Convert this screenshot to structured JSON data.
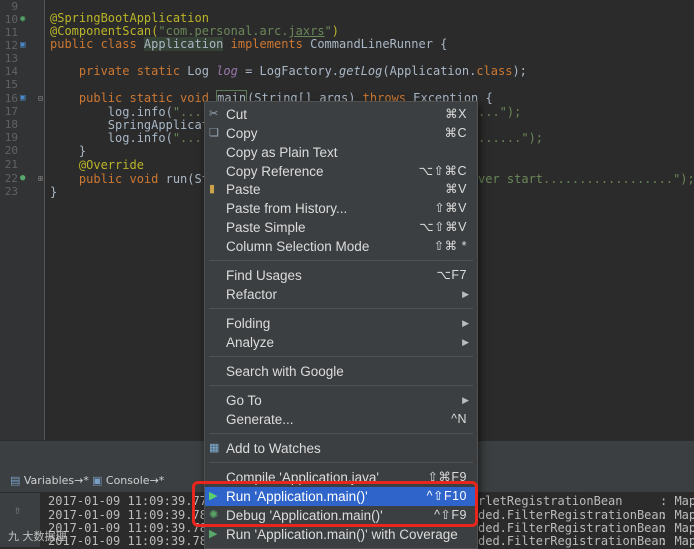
{
  "editor": {
    "line_numbers": [
      "9",
      "10",
      "11",
      "12",
      "13",
      "14",
      "15",
      "16",
      "17",
      "18",
      "19",
      "20",
      "21",
      "22",
      "23"
    ],
    "lines": {
      "l9": "@SpringBootApplication",
      "l10_a": "@ComponentScan(",
      "l10_b": "\"com.personal.arc.",
      "l10_c": "jaxrs",
      "l10_d": "\"",
      "l10_e": ")",
      "l11_a": "public class ",
      "l11_b": "Application",
      "l11_c": " implements ",
      "l11_d": "CommandLineRunner {",
      "l13_a": "    private static ",
      "l13_b": "Log ",
      "l13_c": "log",
      "l13_d": " = LogFactory.",
      "l13_e": "getLog",
      "l13_f": "(Application.",
      "l13_g": "class",
      "l13_h": ");",
      "l16_a": "    public static void ",
      "l16_b": "main",
      "l16_c": "(String[] args) ",
      "l16_d": "throws ",
      "l16_e": "Exception {",
      "l17_a": "        log.info(",
      "l17_b": "\"........",
      "l17_c": "...\");",
      "l18": "        SpringApplication",
      "l19_a": "        log.info(",
      "l19_b": "\"........",
      "l19_c": "......\");",
      "l20": "    }",
      "l21": "    @Override",
      "l22_a": "    public void ",
      "l22_b": "run(Strin",
      "l22_c": "ver start..................\");",
      "l22_d": " }",
      "l23": "}"
    }
  },
  "tool_window": {
    "tabs": [
      {
        "label": "Variables",
        "suffix": "→*"
      },
      {
        "label": "Console",
        "suffix": "→*"
      }
    ]
  },
  "console": {
    "lines": [
      {
        "time": "2017-01-09 11:09:39.778",
        "right": "rletRegistrationBean",
        "tail": ": Mapp"
      },
      {
        "time": "2017-01-09 11:09:39.782",
        "right": "ded.FilterRegistrationBean",
        "tail": ": Mapp"
      },
      {
        "time": "2017-01-09 11:09:39.782",
        "right": "ded.FilterRegistrationBean",
        "tail": ": Mapp"
      },
      {
        "time": "2017-01-09 11:09:39.782",
        "right": "ded.FilterRegistrationBean",
        "tail": ": Mapp"
      }
    ],
    "watermark": "九 大数据理"
  },
  "context_menu": {
    "items": [
      {
        "label": "Cut",
        "shortcut": "⌘X",
        "icon": "scissors-icon"
      },
      {
        "label": "Copy",
        "shortcut": "⌘C",
        "icon": "copy-icon"
      },
      {
        "label": "Copy as Plain Text",
        "shortcut": ""
      },
      {
        "label": "Copy Reference",
        "shortcut": "⌥⇧⌘C"
      },
      {
        "label": "Paste",
        "shortcut": "⌘V",
        "icon": "paste-icon"
      },
      {
        "label": "Paste from History...",
        "shortcut": "⇧⌘V"
      },
      {
        "label": "Paste Simple",
        "shortcut": "⌥⇧⌘V"
      },
      {
        "label": "Column Selection Mode",
        "shortcut": "⇧⌘  *"
      },
      {
        "label": "Find Usages",
        "shortcut": "⌥F7"
      },
      {
        "label": "Refactor",
        "submenu": true
      },
      {
        "label": "Folding",
        "submenu": true
      },
      {
        "label": "Analyze",
        "submenu": true
      },
      {
        "label": "Search with Google",
        "shortcut": ""
      },
      {
        "label": "Go To",
        "submenu": true
      },
      {
        "label": "Generate...",
        "shortcut": "^N"
      },
      {
        "label": "Add to Watches",
        "shortcut": "",
        "icon": "watches-icon"
      },
      {
        "label": "Compile 'Application.java'",
        "shortcut": "⇧⌘F9"
      },
      {
        "label": "Run 'Application.main()'",
        "shortcut": "^⇧F10",
        "icon": "run-icon",
        "active": true
      },
      {
        "label": "Debug 'Application.main()'",
        "shortcut": "^⇧F9",
        "icon": "debug-icon"
      },
      {
        "label": "Run 'Application.main()' with Coverage",
        "shortcut": "",
        "icon": "coverage-icon"
      }
    ]
  },
  "colors": {
    "menu_bg": "#3c3f41",
    "selection": "#2f65ca",
    "highlight_box": "#e8261e",
    "editor_bg": "#2b2b2b"
  }
}
